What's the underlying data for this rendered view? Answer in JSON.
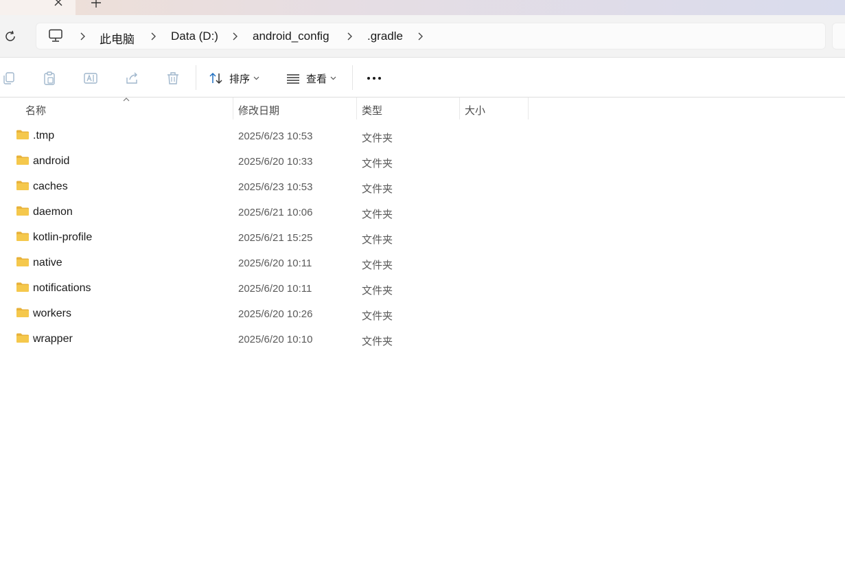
{
  "address": {
    "crumbs": [
      "此电脑",
      "Data (D:)",
      "android_config",
      ".gradle"
    ]
  },
  "toolbar": {
    "sort_label": "排序",
    "view_label": "查看"
  },
  "columns": {
    "name": "名称",
    "modified": "修改日期",
    "type": "类型",
    "size": "大小"
  },
  "files": [
    {
      "name": ".tmp",
      "modified": "2025/6/23 10:53",
      "type": "文件夹"
    },
    {
      "name": "android",
      "modified": "2025/6/20 10:33",
      "type": "文件夹"
    },
    {
      "name": "caches",
      "modified": "2025/6/23 10:53",
      "type": "文件夹"
    },
    {
      "name": "daemon",
      "modified": "2025/6/21 10:06",
      "type": "文件夹"
    },
    {
      "name": "kotlin-profile",
      "modified": "2025/6/21 15:25",
      "type": "文件夹"
    },
    {
      "name": "native",
      "modified": "2025/6/20 10:11",
      "type": "文件夹"
    },
    {
      "name": "notifications",
      "modified": "2025/6/20 10:11",
      "type": "文件夹"
    },
    {
      "name": "workers",
      "modified": "2025/6/20 10:26",
      "type": "文件夹"
    },
    {
      "name": "wrapper",
      "modified": "2025/6/20 10:10",
      "type": "文件夹"
    }
  ],
  "icons": {
    "tab_close": "close-icon",
    "new_tab": "plus-icon",
    "refresh": "refresh-icon",
    "computer": "computer-icon",
    "copy": "copy-icon",
    "paste": "paste-icon",
    "rename": "rename-icon",
    "share": "share-icon",
    "delete": "trash-icon",
    "sort": "sort-icon",
    "view": "view-list-icon",
    "more": "more-icon",
    "folder": "folder-icon"
  },
  "colors": {
    "folder_fill": "#f5c84c",
    "folder_tab": "#e8b23a",
    "disabled_icon": "#9fb6cc",
    "accent": "#1f6fc1"
  }
}
